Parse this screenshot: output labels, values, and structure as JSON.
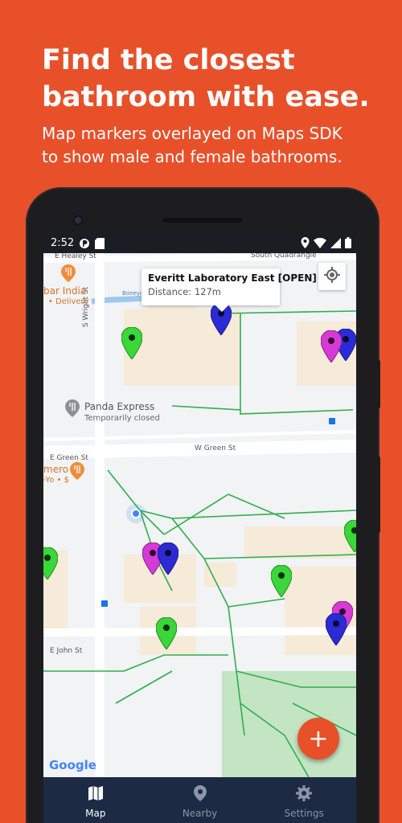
{
  "promo": {
    "headline_line1": "Find the closest",
    "headline_line2": "bathroom with ease.",
    "subline_line1": "Map markers overlayed on Maps SDK",
    "subline_line2": "to show male and female bathrooms."
  },
  "status_bar": {
    "time": "2:52"
  },
  "map": {
    "info_window": {
      "title": "Everitt Laboratory East [OPEN]",
      "distance": "Distance: 127m"
    },
    "labels": {
      "e_healey": "E Healey St",
      "s_wright": "S Wright St",
      "boneyard": "Boneyard Creek",
      "e_green": "E Green St",
      "w_green": "W Green St",
      "e_john": "E John St",
      "quad": "South Quadrangle"
    },
    "pois": {
      "india_name": "bar India",
      "india_sub": "• Delivery",
      "panda_name": "Panda Express",
      "panda_sub": "Temporarily closed",
      "merc_name": "mero",
      "merc_sub": "-Yo • $"
    },
    "google_logo": "Google",
    "fab_label": "+"
  },
  "markers": {
    "colors": {
      "male": "#2b2bd6",
      "female": "#d63ad6",
      "unisex": "#3ad63a"
    }
  },
  "bottom_nav": {
    "items": [
      {
        "label": "Map",
        "icon": "map-icon",
        "active": true
      },
      {
        "label": "Nearby",
        "icon": "location-pin-icon",
        "active": false
      },
      {
        "label": "Settings",
        "icon": "gear-icon",
        "active": false
      }
    ]
  }
}
